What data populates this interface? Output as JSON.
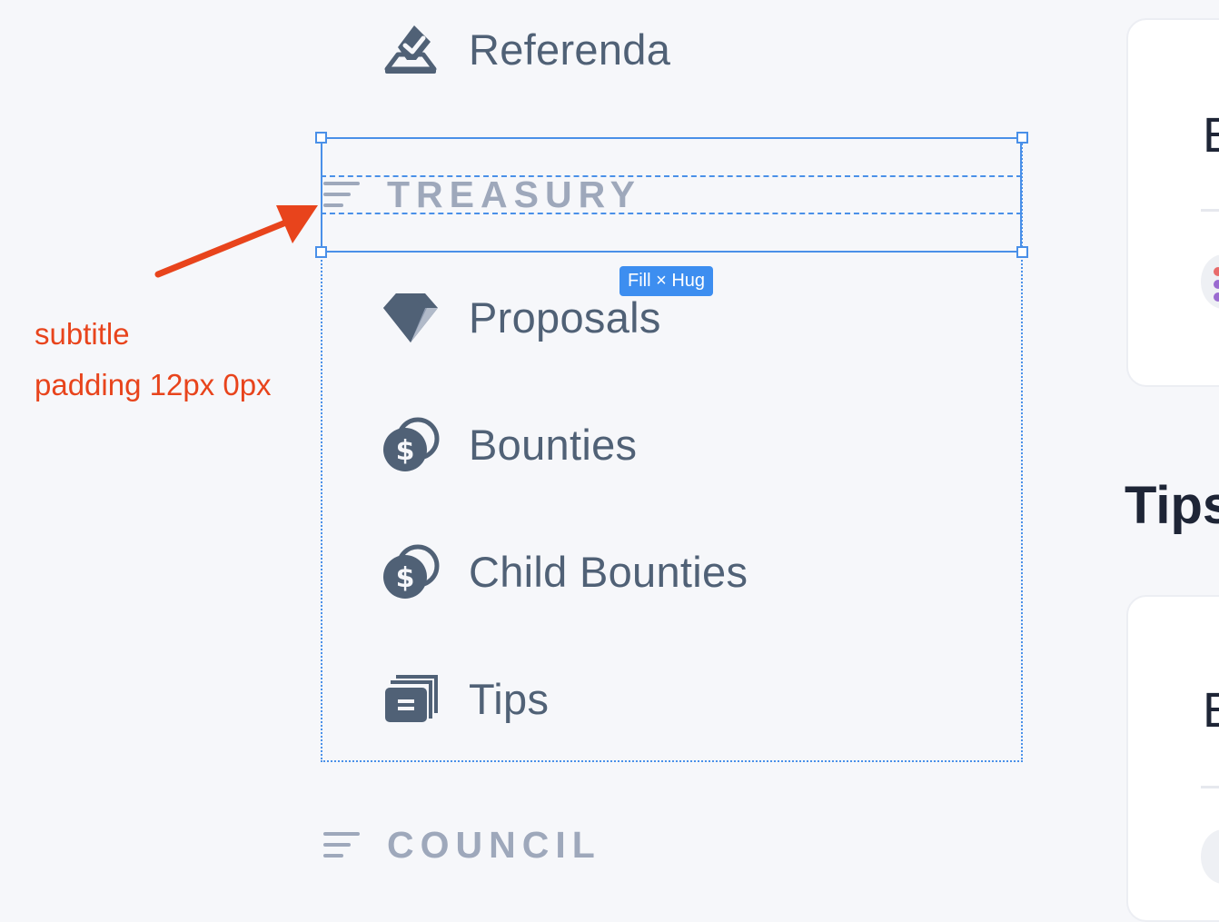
{
  "nav": {
    "referenda": {
      "label": "Referenda",
      "icon": "vote-icon"
    },
    "treasury": {
      "label": "TREASURY",
      "icon": "collapse-lines-icon"
    },
    "proposals": {
      "label": "Proposals",
      "icon": "diamond-icon"
    },
    "bounties": {
      "label": "Bounties",
      "icon": "coins-icon"
    },
    "child_bounties": {
      "label": "Child Bounties",
      "icon": "coins-icon"
    },
    "tips": {
      "label": "Tips",
      "icon": "tips-cards-icon"
    },
    "council": {
      "label": "COUNCIL",
      "icon": "collapse-lines-icon"
    }
  },
  "selection": {
    "size_tag": "Fill × Hug"
  },
  "annotation": {
    "line1": "subtitle",
    "line2": "padding 12px 0px"
  },
  "right_panel": {
    "card1_letter": "E",
    "tips_heading": "Tips",
    "card2_letter": "E"
  },
  "colors": {
    "text": "#506176",
    "subtitle": "#9ea8bb",
    "selection": "#4a90e8",
    "annotation": "#e8441c",
    "background": "#f6f7fa"
  }
}
